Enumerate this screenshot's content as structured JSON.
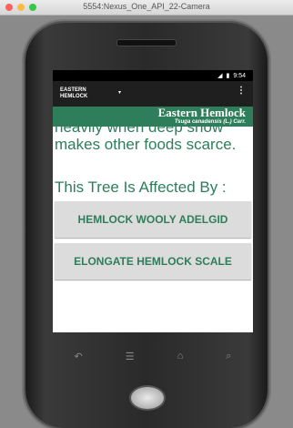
{
  "window": {
    "title": "5554:Nexus_One_API_22-Camera"
  },
  "status": {
    "signal": "◢",
    "battery": "▮",
    "time": "9:54"
  },
  "appbar": {
    "title_line1": "EASTERN",
    "title_line2": "HEMLOCK",
    "dropdown": "▾",
    "menu": "⋮"
  },
  "header": {
    "common_name": "Eastern Hemlock",
    "scientific_name": "Tsuga canadensis (L.) Carr."
  },
  "content": {
    "description_tail": "heavily when deep snow makes other foods scarce.",
    "affected_heading": "This Tree Is Affected By :"
  },
  "pests": [
    {
      "label": "HEMLOCK WOOLY ADELGID"
    },
    {
      "label": "ELONGATE HEMLOCK SCALE"
    }
  ],
  "nav": {
    "back": "↶",
    "menu": "☰",
    "home": "⌂",
    "search": "⌕"
  }
}
